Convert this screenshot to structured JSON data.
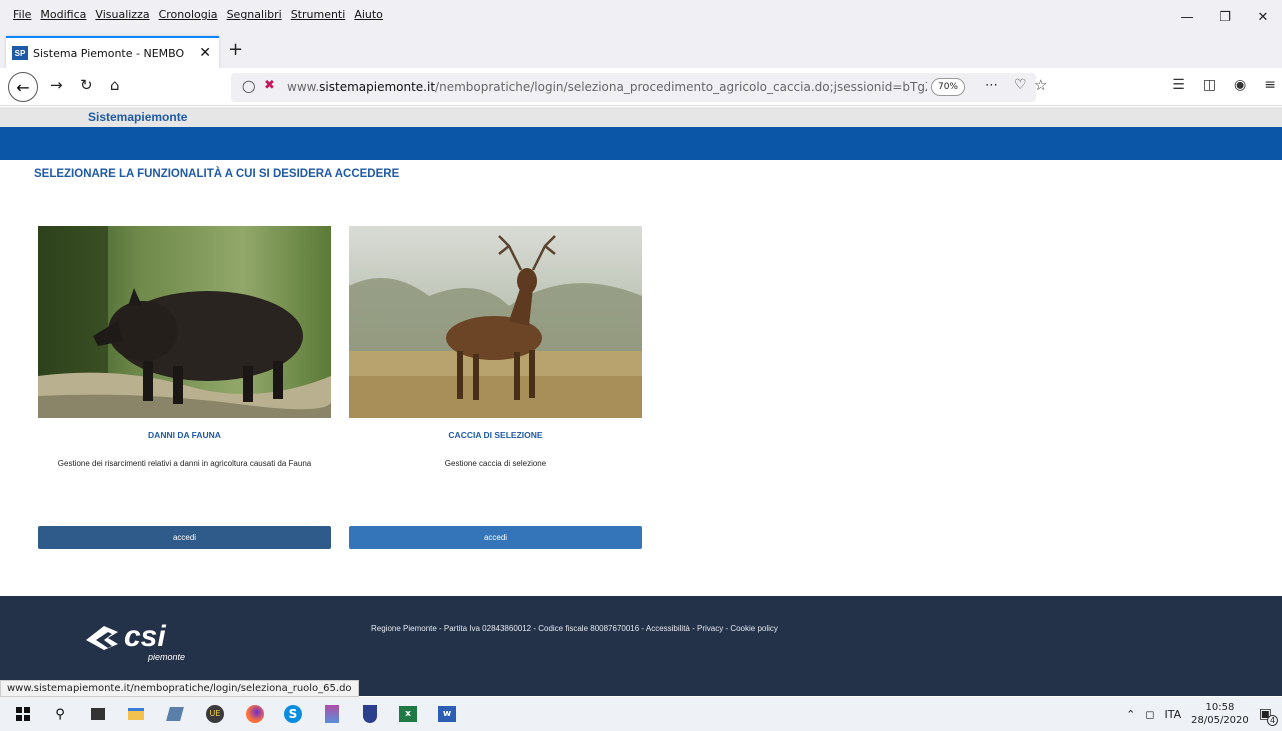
{
  "menubar": {
    "items": [
      "File",
      "Modifica",
      "Visualizza",
      "Cronologia",
      "Segnalibri",
      "Strumenti",
      "Aiuto"
    ]
  },
  "tab": {
    "favicon_text": "SP",
    "title": "Sistema Piemonte - NEMBO"
  },
  "address": {
    "url_prefix": "www.",
    "url_domain": "sistemapiemonte.it",
    "url_path": "/nembopratiche/login/seleziona_procedimento_agricolo_caccia.do;jsessionid=bTgZLMU",
    "zoom": "70%"
  },
  "site": {
    "brand": "Sistemapiemonte",
    "page_title": "SELEZIONARE LA FUNZIONALITÀ A CUI SI DESIDERA ACCEDERE"
  },
  "cards": [
    {
      "title": "DANNI DA FAUNA",
      "description": "Gestione dei risarcimenti relativi a danni in agricoltura causati da Fauna",
      "button": "accedi",
      "button_color": "#2f5b8a"
    },
    {
      "title": "CACCIA DI SELEZIONE",
      "description": "Gestione caccia di selezione",
      "button": "accedi",
      "button_color": "#3474b8"
    }
  ],
  "footer": {
    "legal": "Regione Piemonte - Partita Iva 02843860012 - Codice fiscale 80087670016 - Accessibilità - Privacy - Cookie policy",
    "logo_text": "csi",
    "logo_sub": "piemonte"
  },
  "status_url": "www.sistemapiemonte.it/nembopratiche/login/seleziona_ruolo_65.do",
  "taskbar": {
    "language": "ITA",
    "time": "10:58",
    "date": "28/05/2020",
    "notifications": "4"
  },
  "colors": {
    "brand_blue": "#1f5aa6",
    "header_bar": "#0b56a6",
    "footer_bg": "#233249"
  }
}
